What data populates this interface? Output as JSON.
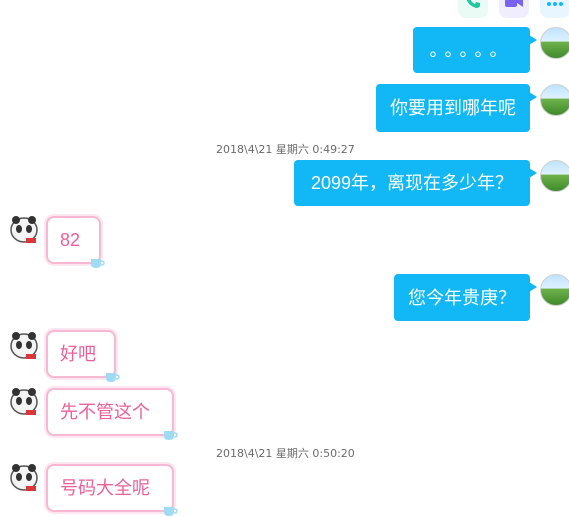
{
  "toolbar": {
    "icons": [
      "phone-icon",
      "video-call-icon",
      "more-icon"
    ],
    "colors": {
      "phone": "#1ec8a0",
      "video": "#7a63f0",
      "more": "#12b7f5"
    }
  },
  "messages": [
    {
      "side": "me",
      "text": "。。。。。"
    },
    {
      "side": "me",
      "text": "你要用到哪年呢"
    },
    {
      "type": "timestamp",
      "text": "2018\\4\\21 星期六 0:49:27"
    },
    {
      "side": "me",
      "text": "2099年，离现在多少年？"
    },
    {
      "side": "other",
      "text": "82"
    },
    {
      "side": "me",
      "text": "您今年贵庚？"
    },
    {
      "side": "other",
      "text": "好吧"
    },
    {
      "side": "other",
      "text": "先不管这个"
    },
    {
      "type": "timestamp",
      "text": "2018\\4\\21 星期六 0:50:20"
    },
    {
      "side": "other",
      "text": "号码大全呢"
    }
  ],
  "colors": {
    "my_bubble": "#12b7f5",
    "other_text": "#e9609b",
    "other_border": "#f6b8d2"
  }
}
